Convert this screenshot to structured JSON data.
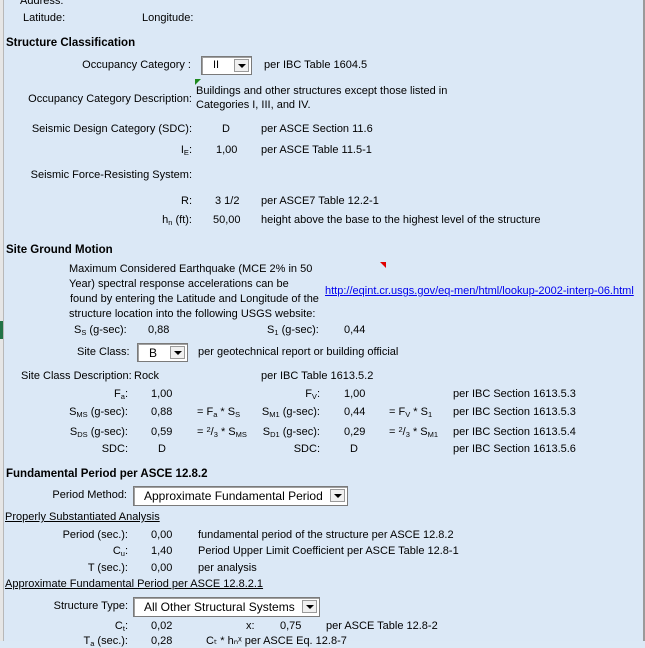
{
  "header": {
    "address_label": "Address:",
    "latitude_label": "Latitude:",
    "longitude_label": "Longitude:"
  },
  "structure_classification": {
    "title": "Structure Classification",
    "occupancy_category_label": "Occupancy Category :",
    "occupancy_category_value": "II",
    "occupancy_category_ref": "per IBC Table 1604.5",
    "occupancy_description_label": "Occupancy Category Description:",
    "occupancy_description_line1": "Buildings and other structures except those listed in",
    "occupancy_description_line2": "Categories I, III, and IV.",
    "sdc_label": "Seismic Design Category (SDC):",
    "sdc_value": "D",
    "sdc_ref": "per ASCE Section 11.6",
    "ie_label_main": "I",
    "ie_label_sub": "E",
    "ie_value": "1,00",
    "ie_ref": "per ASCE Table 11.5-1",
    "sfrs_label": "Seismic Force-Resisting System:",
    "r_label": "R:",
    "r_value": "3 1/2",
    "r_ref": "per ASCE7 Table 12.2-1",
    "hn_label_main": "h",
    "hn_label_sub": "n",
    "hn_label_unit": " (ft):",
    "hn_value": "50,00",
    "hn_ref": "height above the base to the highest level of the structure"
  },
  "site_ground_motion": {
    "title": "Site Ground Motion",
    "mce_text": [
      "Maximum Considered Earthquake (MCE 2% in 50",
      "Year) spectral response accelerations can be",
      "found by entering the Latitude and Longitude of the",
      "structure location into the following USGS website:"
    ],
    "usgs_link": "http://eqint.cr.usgs.gov/eq-men/html/lookup-2002-interp-06.html",
    "ss_label": "S",
    "ss_sub": "S",
    "ss_unit": " (g-sec):",
    "ss_value": "0,88",
    "s1_label": "S",
    "s1_sub": "1",
    "s1_unit": " (g-sec):",
    "s1_value": "0,44",
    "site_class_label": "Site Class:",
    "site_class_value": "B",
    "site_class_ref": "per geotechnical report or building official",
    "site_class_desc_label": "Site Class Description:",
    "site_class_desc_value": "Rock",
    "site_class_desc_ref": "per IBC Table 1613.5.2",
    "fa_value": "1,00",
    "fv_value": "1,00",
    "fv_ref": "per IBC Section 1613.5.3",
    "sms_value": "0,88",
    "sm1_value": "0,44",
    "sm1_ref": "per IBC Section 1613.5.3",
    "sds_value": "0,59",
    "sd1_value": "0,29",
    "sd1_ref": "per IBC Section 1613.5.4",
    "sdc_label": "SDC:",
    "sdc_left_value": "D",
    "sdc_right_value": "D",
    "sdc_ref": "per IBC Section 1613.5.6",
    "unit": " (g-sec):"
  },
  "fundamental_period": {
    "title": "Fundamental Period per ASCE 12.8.2",
    "period_method_label": "Period Method:",
    "period_method_value": "Approximate Fundamental Period",
    "psa_title": "Properly Substantiated Analysis",
    "period_label": "Period (sec.):",
    "period_value": "0,00",
    "period_ref": "fundamental period of the structure per ASCE 12.8.2",
    "cu_value": "1,40",
    "cu_ref": "Period Upper Limit Coefficient per ASCE Table 12.8-1",
    "t_label": "T (sec.):",
    "t_value": "0,00",
    "t_ref": "per analysis",
    "approx_title": "Approximate Fundamental Period per ASCE 12.8.2.1",
    "structure_type_label": "Structure Type:",
    "structure_type_value": "All Other Structural Systems",
    "ct_value": "0,02",
    "x_label": "x:",
    "x_value": "0,75",
    "ct_ref": "per ASCE Table 12.8-2",
    "ta_label": "T",
    "ta_sub": "a",
    "ta_unit": " (sec.):",
    "ta_value": "0,28",
    "ta_ref": "Cₜ * hₙˣ per ASCE Eq. 12.8-7"
  }
}
